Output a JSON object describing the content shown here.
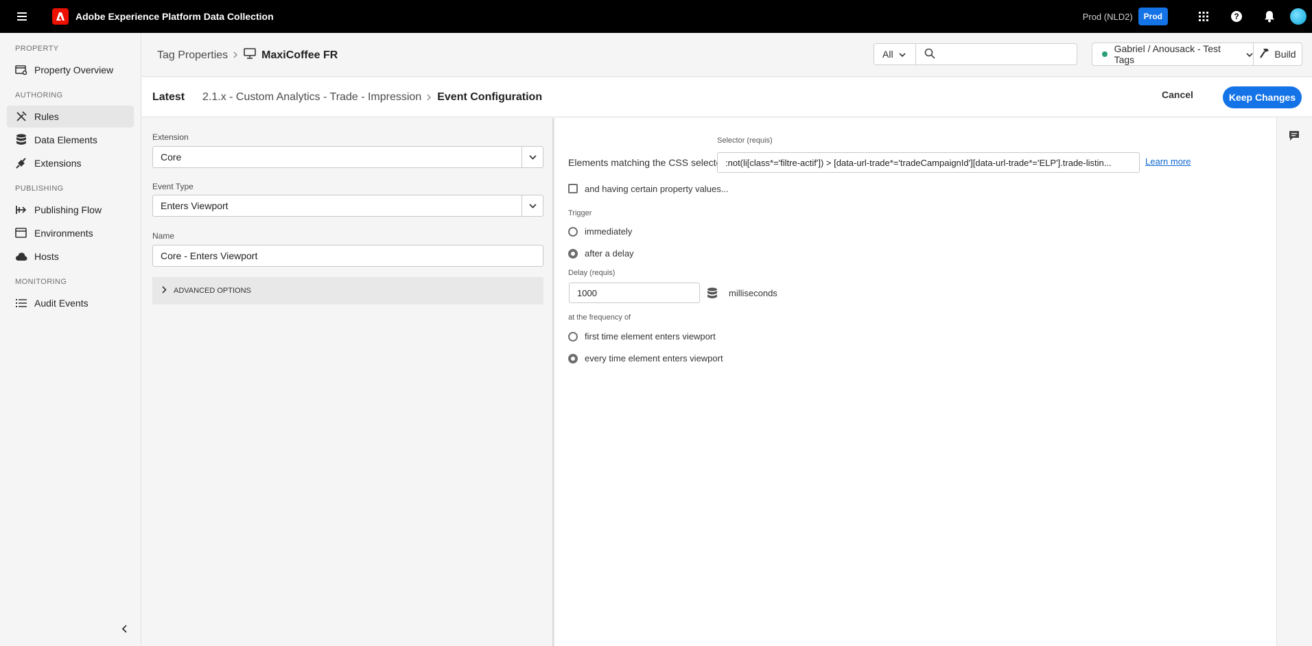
{
  "app": {
    "title": "Adobe Experience Platform Data Collection",
    "org": "Prod (NLD2)",
    "env_badge": "Prod"
  },
  "sidebar": {
    "sections": [
      {
        "label": "PROPERTY"
      },
      {
        "label": "AUTHORING"
      },
      {
        "label": "PUBLISHING"
      },
      {
        "label": "MONITORING"
      }
    ],
    "items": [
      {
        "label": "Property Overview",
        "icon": "property-overview-icon"
      },
      {
        "label": "Rules",
        "icon": "rules-icon",
        "active": true
      },
      {
        "label": "Data Elements",
        "icon": "data-elements-icon"
      },
      {
        "label": "Extensions",
        "icon": "extensions-icon"
      },
      {
        "label": "Publishing Flow",
        "icon": "publishing-flow-icon"
      },
      {
        "label": "Environments",
        "icon": "environments-icon"
      },
      {
        "label": "Hosts",
        "icon": "hosts-icon"
      },
      {
        "label": "Audit Events",
        "icon": "audit-events-icon"
      }
    ]
  },
  "header": {
    "breadcrumb_root": "Tag Properties",
    "property_name": "MaxiCoffee FR",
    "filter_value": "All",
    "search_placeholder": "",
    "library_name": "Gabriel / Anousack - Test Tags",
    "build_label": "Build"
  },
  "actionbar": {
    "latest": "Latest",
    "rule_name": "2.1.x - Custom Analytics - Trade - Impression",
    "current": "Event Configuration",
    "cancel": "Cancel",
    "keep": "Keep Changes"
  },
  "left": {
    "extension_label": "Extension",
    "extension_value": "Core",
    "event_type_label": "Event Type",
    "event_type_value": "Enters Viewport",
    "name_label": "Name",
    "name_value": "Core - Enters Viewport",
    "advanced": "ADVANCED OPTIONS"
  },
  "right": {
    "selector_label_small": "Selector (requis)",
    "selector_label": "Elements matching the CSS selector",
    "selector_value": ":not(li[class*='filtre-actif']) > [data-url-trade*='tradeCampaignId'][data-url-trade*='ELP'].trade-listin...",
    "learn_more": "Learn more",
    "property_values": "and having certain property values...",
    "trigger_label": "Trigger",
    "trigger_immediately": "immediately",
    "trigger_delay": "after a delay",
    "delay_label": "Delay (requis)",
    "delay_value": "1000",
    "delay_unit": "milliseconds",
    "frequency_label": "at the frequency of",
    "freq_first": "first time element enters viewport",
    "freq_every": "every time element enters viewport"
  },
  "colors": {
    "accent": "#1473e6",
    "adobe_red": "#eb1000",
    "status_green": "#2d9d78"
  }
}
